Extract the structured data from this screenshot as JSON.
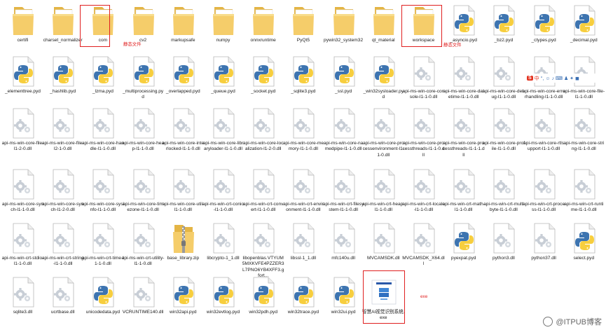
{
  "files": [
    {
      "name": "certifi",
      "type": "folder"
    },
    {
      "name": "charset_normalizer",
      "type": "folder"
    },
    {
      "name": "com",
      "type": "folder",
      "selected": true
    },
    {
      "name": "cv2",
      "type": "folder"
    },
    {
      "name": "markupsafe",
      "type": "folder"
    },
    {
      "name": "numpy",
      "type": "folder"
    },
    {
      "name": "onnxruntime",
      "type": "folder"
    },
    {
      "name": "PyQt5",
      "type": "folder"
    },
    {
      "name": "pywin32_system32",
      "type": "folder"
    },
    {
      "name": "qt_material",
      "type": "folder"
    },
    {
      "name": "workspace",
      "type": "folder",
      "selected": true
    },
    {
      "name": "_asyncio.pyd",
      "type": "python"
    },
    {
      "name": "_bz2.pyd",
      "type": "python"
    },
    {
      "name": "_ctypes.pyd",
      "type": "python"
    },
    {
      "name": "_decimal.pyd",
      "type": "python"
    },
    {
      "name": "_elementtree.pyd",
      "type": "python"
    },
    {
      "name": "_hashlib.pyd",
      "type": "python"
    },
    {
      "name": "_lzma.pyd",
      "type": "python"
    },
    {
      "name": "_multiprocessing.pyd",
      "type": "python"
    },
    {
      "name": "_overlapped.pyd",
      "type": "python"
    },
    {
      "name": "_queue.pyd",
      "type": "python"
    },
    {
      "name": "_socket.pyd",
      "type": "python"
    },
    {
      "name": "_sqlite3.pyd",
      "type": "python"
    },
    {
      "name": "_ssl.pyd",
      "type": "python"
    },
    {
      "name": "_win32sysloader.pyd",
      "type": "python"
    },
    {
      "name": "api-ms-win-core-console-l1-1-0.dll",
      "type": "dll"
    },
    {
      "name": "api-ms-win-core-datetime-l1-1-0.dll",
      "type": "dll"
    },
    {
      "name": "api-ms-win-core-debug-l1-1-0.dll",
      "type": "dll"
    },
    {
      "name": "api-ms-win-core-errorhandling-l1-1-0.dll",
      "type": "dll"
    },
    {
      "name": "api-ms-win-core-file-l1-1-0.dll",
      "type": "dll"
    },
    {
      "name": "api-ms-win-core-file-l1-2-0.dll",
      "type": "dll"
    },
    {
      "name": "api-ms-win-core-file-l2-1-0.dll",
      "type": "dll"
    },
    {
      "name": "api-ms-win-core-handle-l1-1-0.dll",
      "type": "dll"
    },
    {
      "name": "api-ms-win-core-heap-l1-1-0.dll",
      "type": "dll"
    },
    {
      "name": "api-ms-win-core-interlocked-l1-1-0.dll",
      "type": "dll"
    },
    {
      "name": "api-ms-win-core-libraryloader-l1-1-0.dll",
      "type": "dll"
    },
    {
      "name": "api-ms-win-core-localization-l1-2-0.dll",
      "type": "dll"
    },
    {
      "name": "api-ms-win-core-memory-l1-1-0.dll",
      "type": "dll"
    },
    {
      "name": "api-ms-win-core-namedpipe-l1-1-0.dll",
      "type": "dll"
    },
    {
      "name": "api-ms-win-core-processenvironment-l1-1-0.dll",
      "type": "dll"
    },
    {
      "name": "api-ms-win-core-processthreads-l1-1-0.dll",
      "type": "dll"
    },
    {
      "name": "api-ms-win-core-processthreads-l1-1-1.dll",
      "type": "dll"
    },
    {
      "name": "api-ms-win-core-profile-l1-1-0.dll",
      "type": "dll"
    },
    {
      "name": "api-ms-win-core-rtlsupport-l1-1-0.dll",
      "type": "dll"
    },
    {
      "name": "api-ms-win-core-string-l1-1-0.dll",
      "type": "dll"
    },
    {
      "name": "api-ms-win-core-synch-l1-1-0.dll",
      "type": "dll"
    },
    {
      "name": "api-ms-win-core-synch-l1-2-0.dll",
      "type": "dll"
    },
    {
      "name": "api-ms-win-core-sysinfo-l1-1-0.dll",
      "type": "dll"
    },
    {
      "name": "api-ms-win-core-timezone-l1-1-0.dll",
      "type": "dll"
    },
    {
      "name": "api-ms-win-core-util-l1-1-0.dll",
      "type": "dll"
    },
    {
      "name": "api-ms-win-crt-conio-l1-1-0.dll",
      "type": "dll"
    },
    {
      "name": "api-ms-win-crt-convert-l1-1-0.dll",
      "type": "dll"
    },
    {
      "name": "api-ms-win-crt-environment-l1-1-0.dll",
      "type": "dll"
    },
    {
      "name": "api-ms-win-crt-filesystem-l1-1-0.dll",
      "type": "dll"
    },
    {
      "name": "api-ms-win-crt-heap-l1-1-0.dll",
      "type": "dll"
    },
    {
      "name": "api-ms-win-crt-locale-l1-1-0.dll",
      "type": "dll"
    },
    {
      "name": "api-ms-win-crt-math-l1-1-0.dll",
      "type": "dll"
    },
    {
      "name": "api-ms-win-crt-multibyte-l1-1-0.dll",
      "type": "dll"
    },
    {
      "name": "api-ms-win-crt-process-l1-1-0.dll",
      "type": "dll"
    },
    {
      "name": "api-ms-win-crt-runtime-l1-1-0.dll",
      "type": "dll"
    },
    {
      "name": "api-ms-win-crt-stdio-l1-1-0.dll",
      "type": "dll"
    },
    {
      "name": "api-ms-win-crt-string-l1-1-0.dll",
      "type": "dll"
    },
    {
      "name": "api-ms-win-crt-time-l1-1-0.dll",
      "type": "dll"
    },
    {
      "name": "api-ms-win-crt-utility-l1-1-0.dll",
      "type": "dll"
    },
    {
      "name": "base_library.zip",
      "type": "zip"
    },
    {
      "name": "libcrypto-1_1.dll",
      "type": "dll"
    },
    {
      "name": "libopenblas.VTYUM5MXKVFE4PZZER3L7PNO6YB4XFF3.gfort...",
      "type": "dll"
    },
    {
      "name": "libssl-1_1.dll",
      "type": "dll"
    },
    {
      "name": "mfc140u.dll",
      "type": "dll"
    },
    {
      "name": "MVCAMSDK.dll",
      "type": "dll"
    },
    {
      "name": "MVCAMSDK_X64.dll",
      "type": "dll"
    },
    {
      "name": "pyexpat.pyd",
      "type": "python"
    },
    {
      "name": "python3.dll",
      "type": "dll"
    },
    {
      "name": "python37.dll",
      "type": "dll"
    },
    {
      "name": "select.pyd",
      "type": "python"
    },
    {
      "name": "sqlite3.dll",
      "type": "dll"
    },
    {
      "name": "ucrtbase.dll",
      "type": "dll"
    },
    {
      "name": "unicodedata.pyd",
      "type": "python"
    },
    {
      "name": "VCRUNTIME140.dll",
      "type": "dll"
    },
    {
      "name": "win32api.pyd",
      "type": "python"
    },
    {
      "name": "win32evtlog.pyd",
      "type": "python"
    },
    {
      "name": "win32pdh.pyd",
      "type": "python"
    },
    {
      "name": "win32trace.pyd",
      "type": "python"
    },
    {
      "name": "win32ui.pyd",
      "type": "python"
    },
    {
      "name": "智慧AI视觉识别系统.exe",
      "type": "exe",
      "selected": true
    }
  ],
  "annotations": {
    "cv2_note": "静态文件",
    "asyncio_note": "静态文件",
    "exe_note": "exe"
  },
  "ime_toolbar": {
    "logo": "S",
    "lang": "中",
    "items": "°, ☺ ♪ ⌨ ♟ ✦ ◼"
  },
  "watermark": {
    "text": "@ITPUB博客"
  },
  "colors": {
    "selection": "#e02020",
    "folder": "#f5cd6a",
    "python_blue": "#3d74b0",
    "python_yellow": "#f7ce3e"
  }
}
